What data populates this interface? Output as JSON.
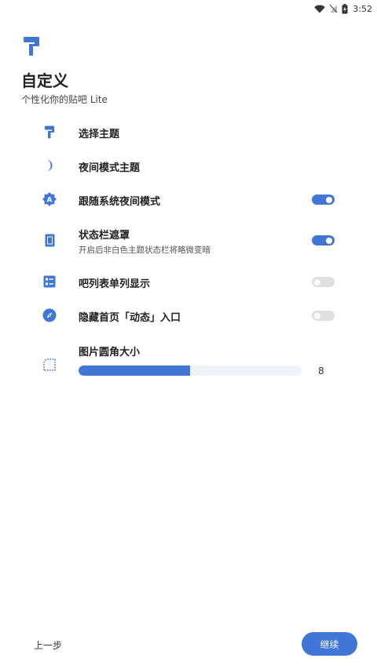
{
  "status_bar": {
    "time": "3:52",
    "icons": [
      "wifi-icon",
      "no-signal-icon",
      "battery-charging-icon"
    ]
  },
  "header": {
    "logo_icon": "paint-roller-icon",
    "title": "自定义",
    "subtitle": "个性化你的贴吧 Lite"
  },
  "settings": {
    "theme": {
      "label": "选择主题",
      "icon": "paint-roller-icon"
    },
    "night_theme": {
      "label": "夜间模式主题",
      "icon": "moon-icon"
    },
    "follow_system": {
      "label": "跟随系统夜间模式",
      "icon": "auto-brightness-icon",
      "enabled": true
    },
    "status_bar_mask": {
      "label": "状态栏遮罩",
      "description": "开启后非白色主题状态栏将略微变暗",
      "icon": "phone-icon",
      "enabled": true
    },
    "single_column": {
      "label": "吧列表单列显示",
      "icon": "list-icon",
      "enabled": false
    },
    "hide_dynamic": {
      "label": "隐藏首页「动态」入口",
      "icon": "compass-icon",
      "enabled": false
    },
    "image_radius": {
      "label": "图片圆角大小",
      "icon": "rounded-corner-icon",
      "value": "8",
      "fill_fraction": 0.5
    }
  },
  "footer": {
    "back_label": "上一步",
    "continue_label": "继续"
  },
  "colors": {
    "accent": "#3f76d8",
    "toggle_off": "#e0e0e0",
    "track": "#eef3fb"
  }
}
